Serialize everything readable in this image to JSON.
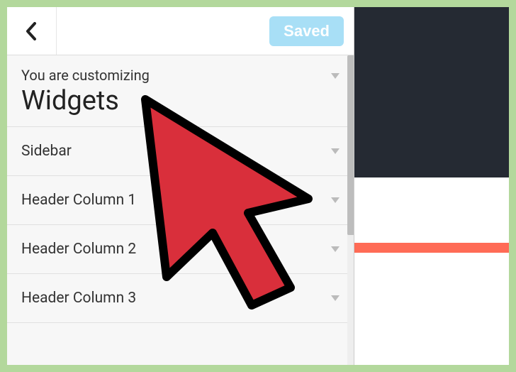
{
  "header": {
    "saved_label": "Saved"
  },
  "customizing": {
    "label": "You are customizing",
    "title": "Widgets"
  },
  "sections": [
    {
      "label": "Sidebar"
    },
    {
      "label": "Header Column 1"
    },
    {
      "label": "Header Column 2"
    },
    {
      "label": "Header Column 3"
    }
  ],
  "colors": {
    "preview_dark": "#252a33",
    "preview_accent": "#ff6b56",
    "saved_btn": "#a8dff6"
  }
}
